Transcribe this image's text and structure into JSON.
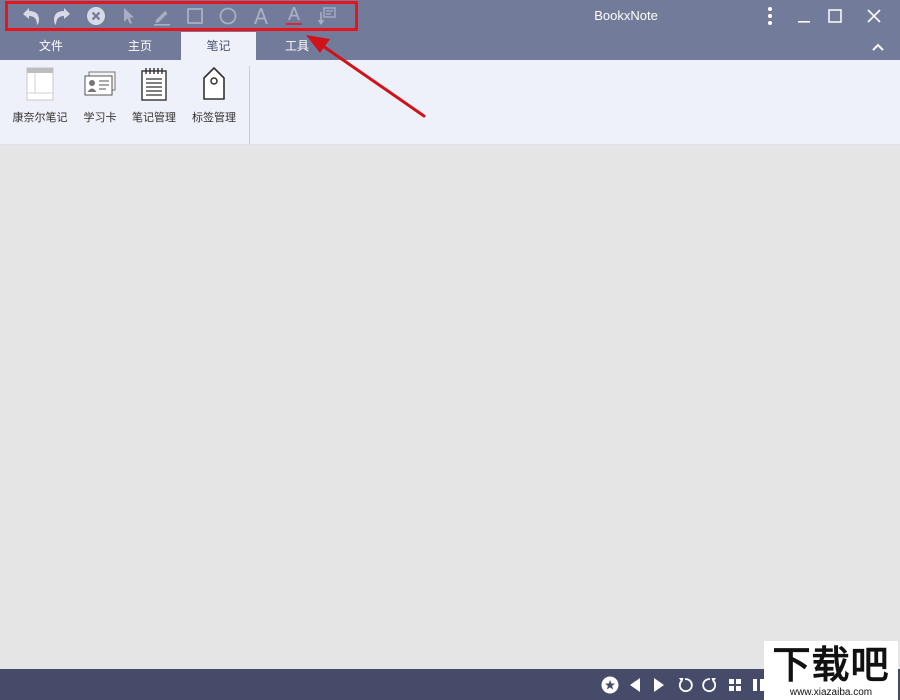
{
  "app": {
    "title": "BookxNote"
  },
  "quick_access": {
    "buttons": [
      {
        "icon": "undo-icon"
      },
      {
        "icon": "redo-icon"
      },
      {
        "icon": "close-circle-icon"
      },
      {
        "icon": "pointer-icon"
      },
      {
        "icon": "pen-icon"
      },
      {
        "icon": "rectangle-icon"
      },
      {
        "icon": "ellipse-icon"
      },
      {
        "icon": "text-icon"
      },
      {
        "icon": "underline-text-icon"
      },
      {
        "icon": "note-insert-icon"
      }
    ],
    "highlight_color": "#e8141c"
  },
  "window_controls": [
    {
      "icon": "more-vertical-icon"
    },
    {
      "icon": "minimize-icon"
    },
    {
      "icon": "maximize-icon"
    },
    {
      "icon": "close-icon"
    }
  ],
  "tabs": [
    {
      "label": "文件",
      "active": false
    },
    {
      "label": "主页",
      "active": false
    },
    {
      "label": "笔记",
      "active": true
    },
    {
      "label": "工具",
      "active": false
    }
  ],
  "ribbon": {
    "buttons": [
      {
        "label": "康奈尔笔记",
        "icon": "cornell-note-icon"
      },
      {
        "label": "学习卡",
        "icon": "study-card-icon"
      },
      {
        "label": "笔记管理",
        "icon": "note-manage-icon"
      },
      {
        "label": "标签管理",
        "icon": "tag-manage-icon"
      }
    ]
  },
  "status_bar": {
    "buttons": [
      {
        "icon": "star-badge-icon"
      },
      {
        "icon": "previous-icon"
      },
      {
        "icon": "next-icon"
      },
      {
        "icon": "rotate-left-icon"
      },
      {
        "icon": "rotate-right-icon"
      },
      {
        "icon": "grid-view-icon"
      },
      {
        "icon": "columns-view-icon"
      }
    ]
  },
  "watermark": {
    "text": "下载吧",
    "url": "www.xiazaiba.com"
  },
  "colors": {
    "titlebar": "#737b9a",
    "ribbon_bg": "#eef0fa",
    "workspace": "#e5e5e5",
    "statusbar": "#454b68",
    "annotation_arrow": "#d0121a"
  }
}
